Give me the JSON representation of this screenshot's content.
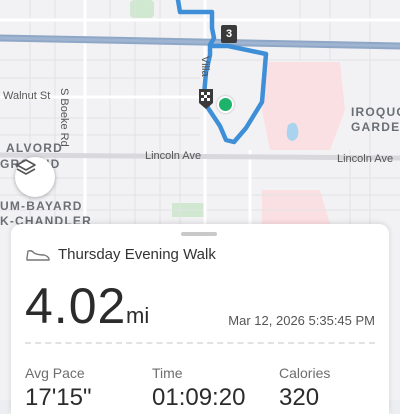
{
  "map": {
    "road_labels": {
      "walnut": "Walnut St",
      "boeke": "S Boeke Rd",
      "lincoln_left": "Lincoln Ave",
      "lincoln_right": "Lincoln Ave",
      "vertical_road": "Villa"
    },
    "area_labels": {
      "alvord_1": "ALVORD",
      "alvord_2": "GROUND",
      "bayard": "UM-BAYARD",
      "chandler": "K-CHANDLER",
      "iroquois_1": "IROQUO",
      "iroquois_2": "GARDE"
    },
    "marker_label": "3",
    "route_color": "#3f8fd8",
    "start_color": "#1db36a",
    "icons": {
      "layers": "layers-icon",
      "flag": "checkered-flag-icon",
      "shoe": "shoe-icon"
    }
  },
  "activity": {
    "title": "Thursday Evening Walk",
    "distance": "4.02",
    "distance_unit": "mi",
    "datetime": "Mar 12, 2026 5:35:45 PM",
    "stats": [
      {
        "label": "Avg Pace",
        "value": "17'15\""
      },
      {
        "label": "Time",
        "value": "01:09:20"
      },
      {
        "label": "Calories",
        "value": "320"
      }
    ]
  }
}
